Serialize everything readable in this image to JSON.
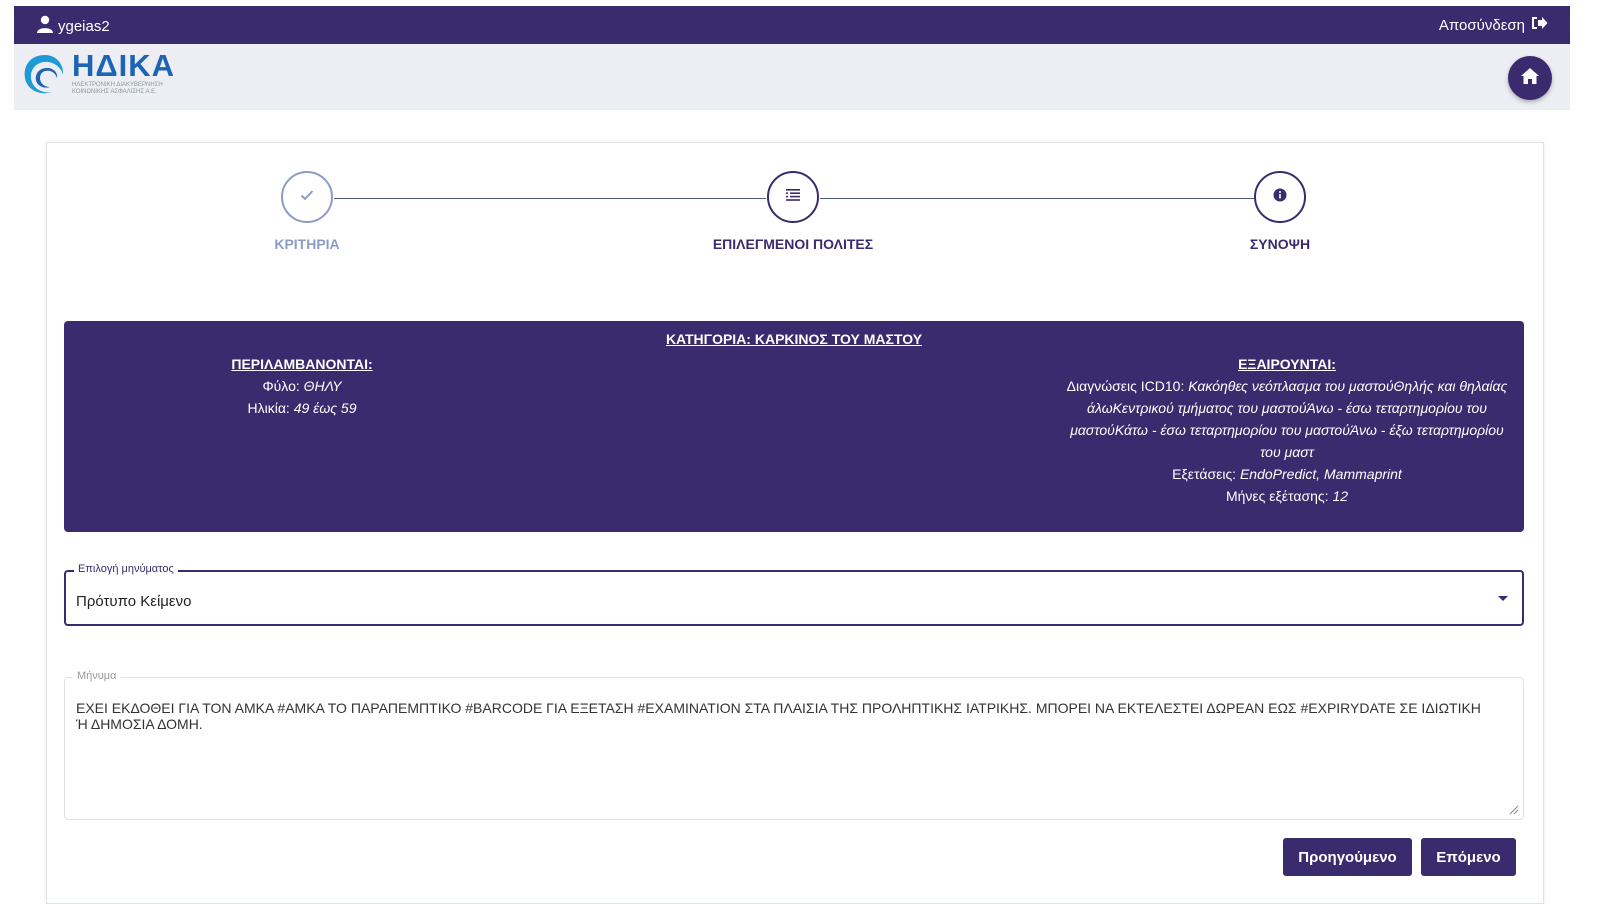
{
  "header": {
    "username": "ygeias2",
    "logout_label": "Αποσύνδεση",
    "user_icon": "user-icon",
    "logout_icon": "sign-out-icon"
  },
  "brand": {
    "name": "ΗΔΙΚΑ",
    "subtitle": "ΗΛΕΚΤΡΟΝΙΚΗ ΔΙΑΚΥΒΕΡΝΗΣΗ ΚΟΙΝΩΝΙΚΗΣ ΑΣΦΑΛΙΣΗΣ Α.Ε.",
    "home_icon": "home-icon"
  },
  "stepper": {
    "steps": [
      {
        "label": "ΚΡΙΤΗΡΙΑ",
        "icon": "check-icon",
        "state": "completed"
      },
      {
        "label": "ΕΠΙΛΕΓΜΕΝΟΙ ΠΟΛΙΤΕΣ",
        "icon": "list-icon",
        "state": "active"
      },
      {
        "label": "ΣΥΝΟΨΗ",
        "icon": "info-icon",
        "state": "pending"
      }
    ]
  },
  "category": {
    "title": "ΚΑΤΗΓΟΡΙΑ: ΚΑΡΚΙΝΟΣ ΤΟΥ ΜΑΣΤΟΥ",
    "included": {
      "heading": "ΠΕΡΙΛΑΜΒΑΝΟΝΤΑΙ:",
      "gender_label": "Φύλο:",
      "gender_value": "ΘΗΛΥ",
      "age_label": "Ηλικία:",
      "age_value": "49 έως 59"
    },
    "excluded": {
      "heading": "ΕΞΑΙΡΟΥΝΤΑΙ:",
      "diagnoses_label": "Διαγνώσεις ICD10:",
      "diagnoses_value": "Κακόηθες νεόπλασμα του μαστούΘηλής και θηλαίας άλωΚεντρικού τμήματος του μαστούΆνω - έσω τεταρτημορίου του μαστούΚάτω - έσω τεταρτημορίου του μαστούΆνω - έξω τεταρτημορίου του μαστ",
      "exams_label": "Εξετάσεις:",
      "exams_value": "EndoPredict, Mammaprint",
      "months_label": "Μήνες εξέτασης:",
      "months_value": "12"
    }
  },
  "form": {
    "select_label": "Επιλογή μηνύματος",
    "select_value": "Πρότυπο Κείμενο",
    "message_label": "Μήνυμα",
    "message_text": "ΕΧΕΙ ΕΚΔΟΘΕΙ ΓΙΑ ΤΟΝ ΑΜΚΑ #ΑΜΚΑ ΤΟ ΠΑΡΑΠΕΜΠΤΙΚΟ #BARCODE ΓΙΑ ΕΞΕΤΑΣΗ #EXAMINATION ΣΤΑ ΠΛΑΙΣΙΑ ΤΗΣ ΠΡΟΛΗΠΤΙΚΗΣ ΙΑΤΡΙΚΗΣ. ΜΠΟΡΕΙ ΝΑ ΕΚΤΕΛΕΣΤΕΙ ΔΩΡΕΑΝ ΕΩΣ #EXPIRYDATE ΣΕ ΙΔΙΩΤΙΚΗ Ή ΔΗΜΟΣΙΑ ΔΟΜΗ."
  },
  "actions": {
    "previous_label": "Προηγούμενο",
    "next_label": "Επόμενο"
  },
  "colors": {
    "primary": "#3a2b6e",
    "completed_step": "#8e9bc6",
    "brand_blue": "#1e64b5"
  }
}
